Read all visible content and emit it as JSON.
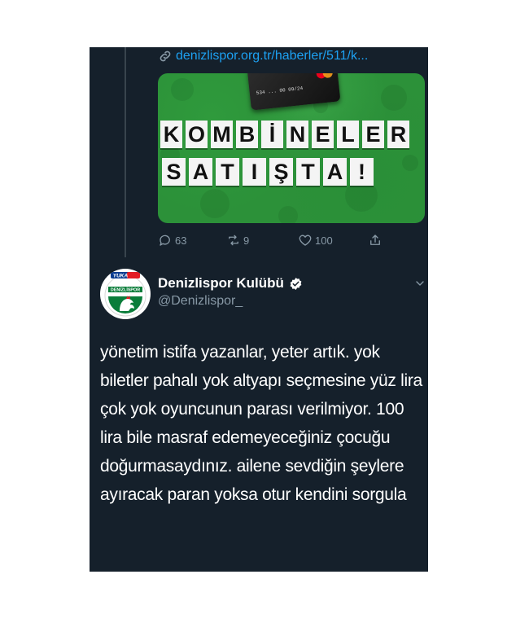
{
  "link": {
    "text": "denizlispor.org.tr/haberler/511/k..."
  },
  "card": {
    "title_row1": [
      "K",
      "O",
      "M",
      "B",
      "İ",
      "N",
      "E",
      "L",
      "E",
      "R"
    ],
    "title_row2": [
      "S",
      "A",
      "T",
      "I",
      "Ş",
      "T",
      "A",
      "!"
    ],
    "card_number": "534 ... 00 09/24"
  },
  "actions": {
    "replies": "63",
    "retweets": "9",
    "likes": "100"
  },
  "author": {
    "name": "Denizlispor Kulübü",
    "handle": "@Denizlispor_",
    "avatar_text_top": "YUKA",
    "avatar_text_club": "DENİZLİSPOR"
  },
  "tweet": {
    "text": "yönetim istifa yazanlar, yeter artık. yok biletler pahalı yok altyapı seçmesine yüz lira çok yok oyuncunun parası verilmiyor.  100 lira bile masraf edemeyeceğiniz çocuğu doğurmasaydınız. ailene sevdiğin şeylere ayıracak paran yoksa otur kendini sorgula"
  },
  "colors": {
    "background": "#15202b",
    "link": "#1da1f2",
    "muted": "#8899a6",
    "card_green": "#2c9139",
    "verified": "#ffffff"
  },
  "icons": [
    "link-icon",
    "reply-icon",
    "retweet-icon",
    "like-icon",
    "share-icon",
    "verified-icon",
    "chevron-down-icon"
  ]
}
